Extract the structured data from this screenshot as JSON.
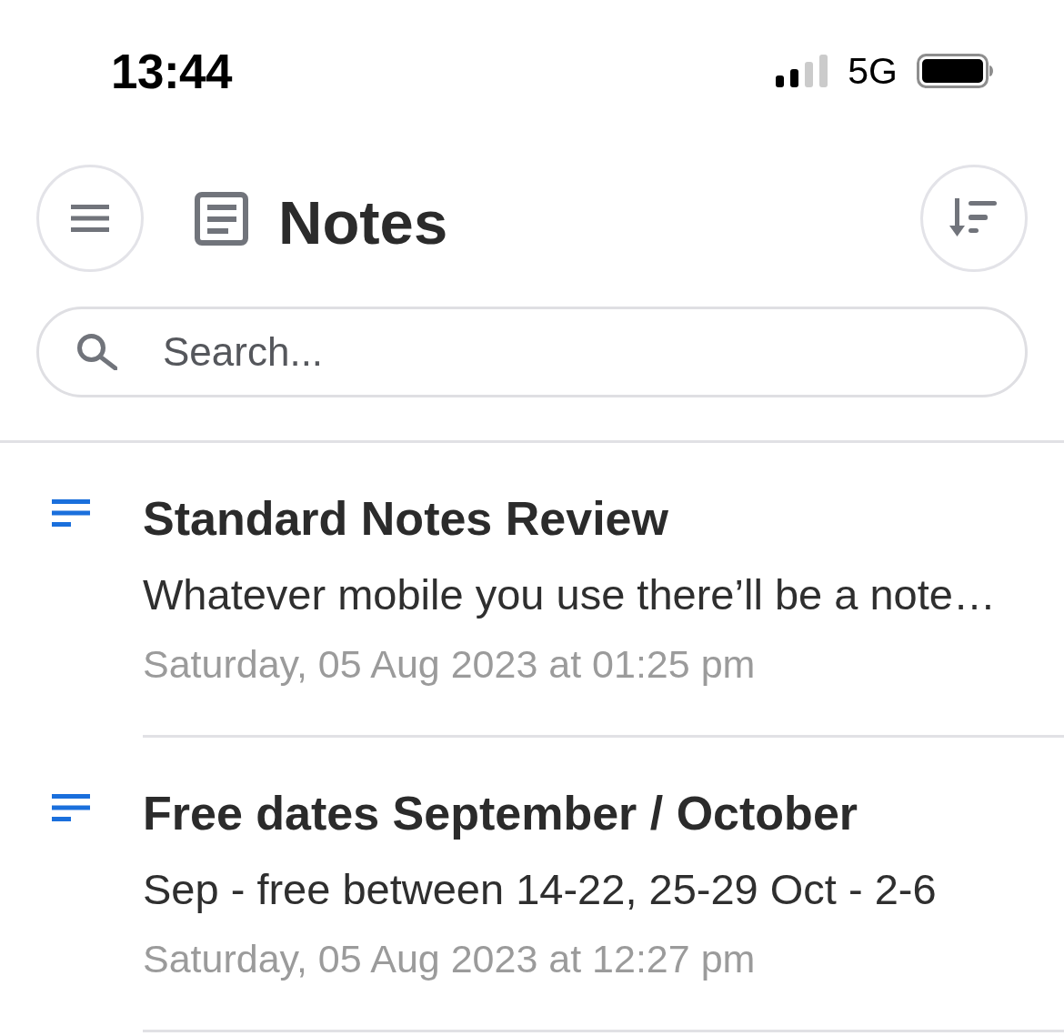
{
  "status_bar": {
    "time": "13:44",
    "network": "5G"
  },
  "header": {
    "title": "Notes"
  },
  "search": {
    "placeholder": "Search..."
  },
  "notes": [
    {
      "title": "Standard Notes Review",
      "preview": "Whatever mobile you use there’ll be a note…",
      "date": "Saturday, 05 Aug 2023 at 01:25 pm"
    },
    {
      "title": "Free dates September / October",
      "preview": "Sep - free between 14-22, 25-29 Oct - 2-6",
      "date": "Saturday, 05 Aug 2023 at 12:27 pm"
    }
  ]
}
